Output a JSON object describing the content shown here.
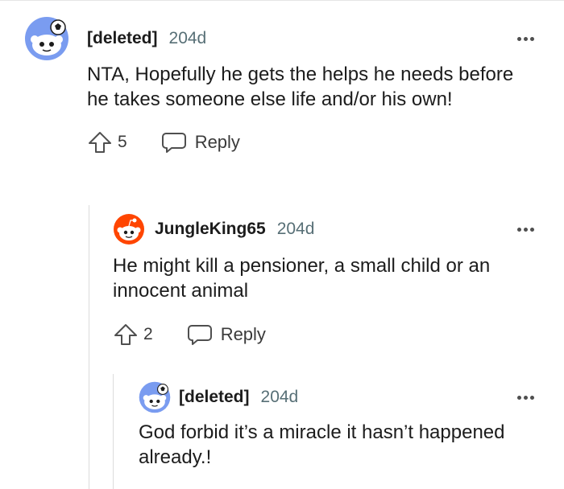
{
  "comments": [
    {
      "author": "[deleted]",
      "age": "204d",
      "body": "NTA, Hopefully he gets the helps he needs before he takes someone else life and/or his own!",
      "votes": "5",
      "reply_label": "Reply",
      "avatar_icon": "snoo-deleted-avatar-icon"
    },
    {
      "author": "JungleKing65",
      "age": "204d",
      "body": "He might kill a pensioner, a small child or an innocent animal",
      "votes": "2",
      "reply_label": "Reply",
      "avatar_icon": "snoo-orange-avatar-icon"
    },
    {
      "author": "[deleted]",
      "age": "204d",
      "body": "God forbid it’s a miracle it hasn’t happened already.!",
      "avatar_icon": "snoo-deleted-avatar-icon"
    }
  ],
  "colors": {
    "deleted_avatar": "#7a9cf0",
    "orange_avatar": "#ff4500",
    "meta_text": "#576f76",
    "thread_line": "#dcdcdc"
  }
}
